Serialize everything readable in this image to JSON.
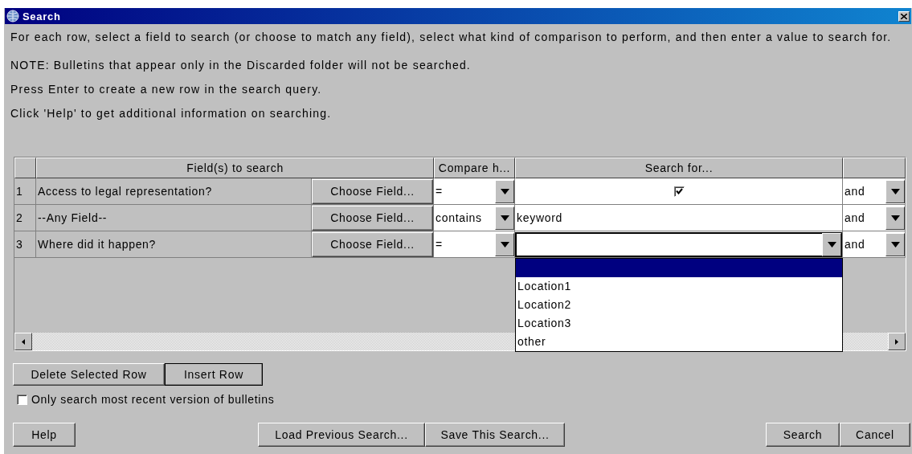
{
  "window": {
    "title": "Search"
  },
  "instructions": [
    "For each row, select a field to search (or choose to match any field), select what kind of comparison to perform, and then enter a value to search for.",
    "NOTE: Bulletins that appear only in the Discarded folder will not be searched.",
    "Press Enter to create a new row in the search query.",
    "Click 'Help' to get additional information on searching."
  ],
  "table": {
    "columns": [
      "Field(s) to search",
      "Compare h...",
      "Search for..."
    ],
    "rows": [
      {
        "number": "1",
        "field": "Access to legal representation?",
        "choose_label": "Choose Field...",
        "compare": "=",
        "kind": "checkbox",
        "checked": true,
        "connector": "and"
      },
      {
        "number": "2",
        "field": "--Any Field--",
        "choose_label": "Choose Field...",
        "compare": "contains",
        "kind": "text",
        "value": "keyword",
        "connector": "and"
      },
      {
        "number": "3",
        "field": "Where did it happen?",
        "choose_label": "Choose Field...",
        "compare": "=",
        "kind": "dropdown",
        "expanded": true,
        "options": [
          {
            "selected": true
          },
          {
            "label": "Location1",
            "selected": false
          },
          {
            "label": "Location2",
            "selected": false
          },
          {
            "label": "Location3",
            "selected": false
          },
          {
            "label": "other",
            "selected": false
          }
        ],
        "connector": "and"
      }
    ]
  },
  "row_buttons": [
    {
      "label": "Delete Selected Row",
      "focused": false
    },
    {
      "label": "Insert Row",
      "focused": true
    }
  ],
  "recent_only": {
    "label": "Only search most recent version of bulletins",
    "checked": false
  },
  "footer": {
    "left": [
      "Help"
    ],
    "center": [
      "Load Previous Search...",
      "Save This Search..."
    ],
    "right": [
      "Search",
      "Cancel"
    ]
  }
}
